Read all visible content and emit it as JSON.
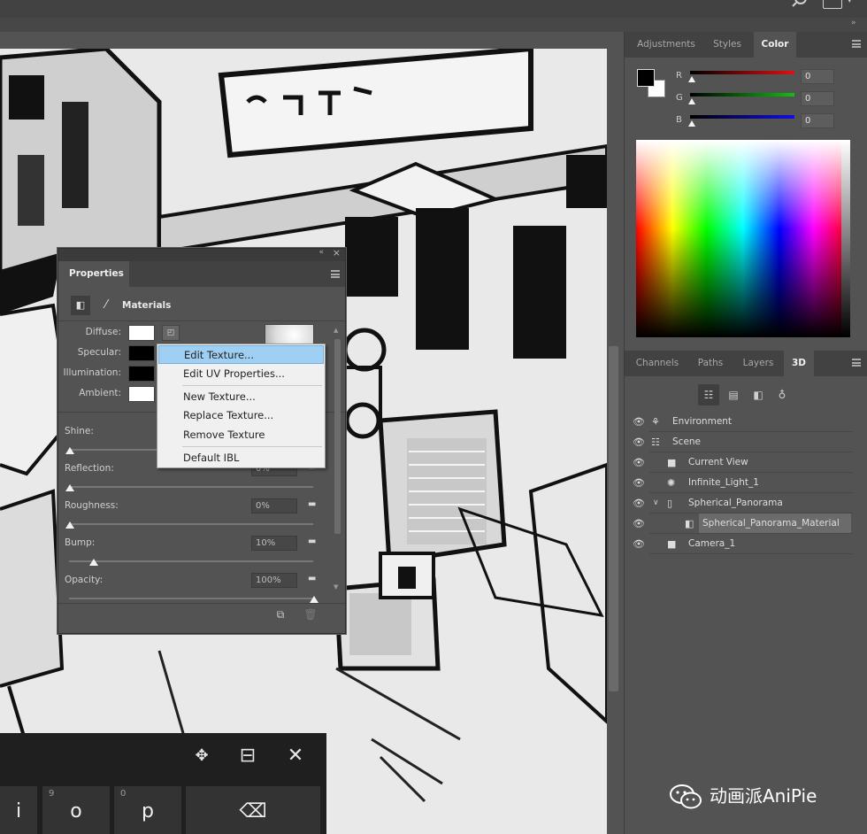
{
  "topbar": {
    "search_icon": "search-icon",
    "workspace_icon": "workspace-icon"
  },
  "color_panel": {
    "tabs": [
      {
        "label": "Adjustments",
        "active": false
      },
      {
        "label": "Styles",
        "active": false
      },
      {
        "label": "Color",
        "active": true
      }
    ],
    "channels": [
      {
        "label": "R",
        "value": "0",
        "color": "#e01010"
      },
      {
        "label": "G",
        "value": "0",
        "color": "#10c010"
      },
      {
        "label": "B",
        "value": "0",
        "color": "#1010e0"
      }
    ],
    "foreground": "#000000",
    "background": "#ffffff"
  },
  "panel_3d": {
    "tabs": [
      {
        "label": "Channels",
        "active": false
      },
      {
        "label": "Paths",
        "active": false
      },
      {
        "label": "Layers",
        "active": false
      },
      {
        "label": "3D",
        "active": true
      }
    ],
    "filter_icons": [
      "scene-filter-icon",
      "mesh-filter-icon",
      "material-filter-icon",
      "light-filter-icon"
    ],
    "items": [
      {
        "label": "Environment",
        "eye": true,
        "indent": 0,
        "icon": "environment-icon"
      },
      {
        "label": "Scene",
        "eye": true,
        "indent": 0,
        "icon": "scene-icon"
      },
      {
        "label": "Current View",
        "eye": true,
        "indent": 1,
        "icon": "camera-icon"
      },
      {
        "label": "Infinite_Light_1",
        "eye": true,
        "indent": 1,
        "icon": "light-icon"
      },
      {
        "label": "Spherical_Panorama",
        "eye": true,
        "indent": 1,
        "icon": "mesh-icon",
        "expanded": true
      },
      {
        "label": "Spherical_Panorama_Material",
        "eye": true,
        "indent": 2,
        "icon": "material-icon",
        "selected": true
      },
      {
        "label": "Camera_1",
        "eye": true,
        "indent": 1,
        "icon": "camera-icon"
      }
    ]
  },
  "properties": {
    "title": "Properties",
    "section": "Materials",
    "swatches": [
      {
        "label": "Diffuse:",
        "color": "#ffffff"
      },
      {
        "label": "Specular:",
        "color": "#000000"
      },
      {
        "label": "Illumination:",
        "color": "#000000"
      },
      {
        "label": "Ambient:",
        "color": "#ffffff"
      }
    ],
    "sliders": [
      {
        "label": "Shine:",
        "value": "",
        "fraction": 0.0
      },
      {
        "label": "Reflection:",
        "value": "0%",
        "fraction": 0.0
      },
      {
        "label": "Roughness:",
        "value": "0%",
        "fraction": 0.0
      },
      {
        "label": "Bump:",
        "value": "10%",
        "fraction": 0.1
      },
      {
        "label": "Opacity:",
        "value": "100%",
        "fraction": 1.0
      }
    ]
  },
  "context_menu": {
    "items": [
      {
        "label": "Edit Texture...",
        "highlighted": true
      },
      {
        "label": "Edit UV Properties...",
        "highlighted": false
      },
      {
        "label": "New Texture...",
        "highlighted": false
      },
      {
        "label": "Replace Texture...",
        "highlighted": false
      },
      {
        "label": "Remove Texture",
        "highlighted": false
      },
      {
        "label": "Default IBL",
        "highlighted": false
      }
    ]
  },
  "keyboard": {
    "toolbar_icons": [
      "move-icon",
      "dock-icon",
      "close-icon"
    ],
    "keys": [
      {
        "main": "i",
        "sub": ""
      },
      {
        "main": "o",
        "sub": "9"
      },
      {
        "main": "p",
        "sub": "0"
      },
      {
        "main": "⌫",
        "sub": "",
        "icon": "backspace-icon"
      }
    ]
  },
  "watermark": {
    "text": "动画派AniPie"
  }
}
